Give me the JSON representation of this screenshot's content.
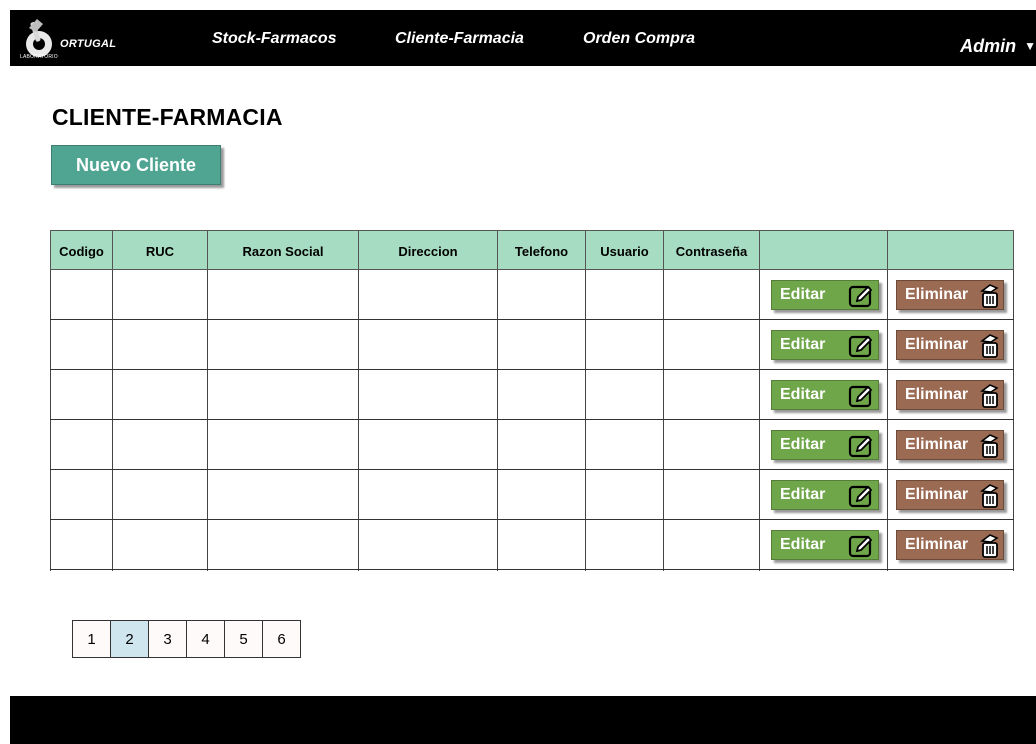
{
  "header": {
    "logo_text": "ORTUGAL",
    "logo_sub": "LABORATORIO",
    "nav": [
      "Stock-Farmacos",
      "Cliente-Farmacia",
      "Orden Compra"
    ],
    "user_label": "Admin"
  },
  "main": {
    "title": "CLIENTE-FARMACIA",
    "new_button": "Nuevo Cliente"
  },
  "table": {
    "columns": [
      "Codigo",
      "RUC",
      "Razon Social",
      "Direccion",
      "Telefono",
      "Usuario",
      "Contraseña",
      "",
      ""
    ],
    "rows": [
      {
        "edit_label": "Editar",
        "delete_label": "Eliminar"
      },
      {
        "edit_label": "Editar",
        "delete_label": "Eliminar"
      },
      {
        "edit_label": "Editar",
        "delete_label": "Eliminar"
      },
      {
        "edit_label": "Editar",
        "delete_label": "Eliminar"
      },
      {
        "edit_label": "Editar",
        "delete_label": "Eliminar"
      },
      {
        "edit_label": "Editar",
        "delete_label": "Eliminar"
      }
    ]
  },
  "pagination": {
    "pages": [
      "1",
      "2",
      "3",
      "4",
      "5",
      "6"
    ],
    "current": "2"
  },
  "colors": {
    "header_bg": "#000000",
    "table_header": "#a6dcc2",
    "new_button": "#4fa592",
    "edit_button": "#70a64a",
    "delete_button": "#9b6a53",
    "active_page": "#cfe6ee"
  }
}
